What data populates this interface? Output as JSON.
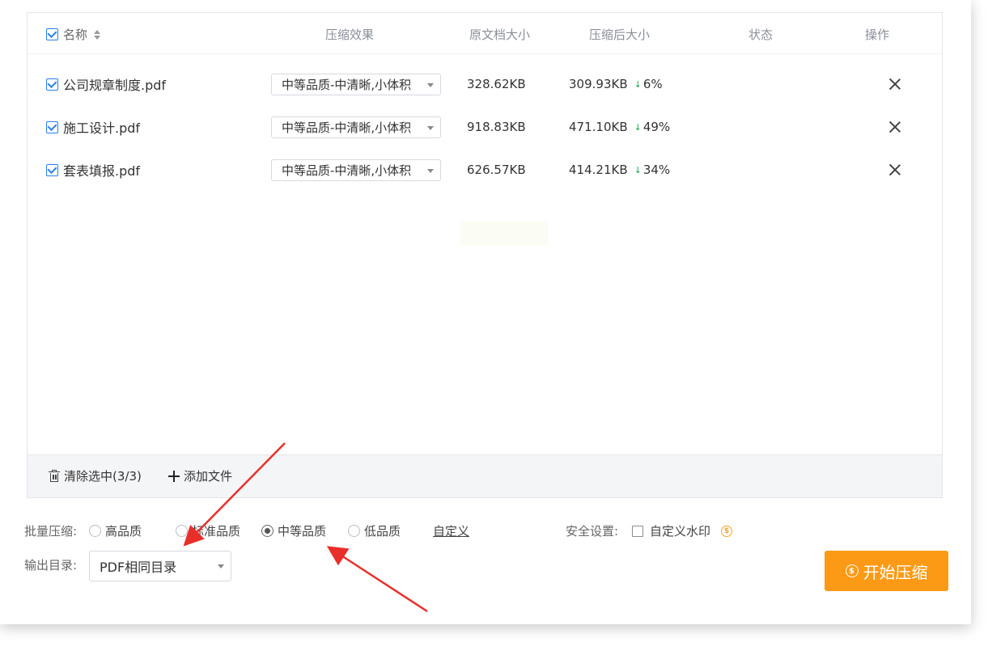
{
  "table": {
    "headers": {
      "name": "名称",
      "effect": "压缩效果",
      "original_size": "原文档大小",
      "compressed_size": "压缩后大小",
      "status": "状态",
      "operation": "操作"
    },
    "rows": [
      {
        "name": "公司规章制度.pdf",
        "effect": "中等品质-中清晰,小体积",
        "original": "328.62KB",
        "compressed": "309.93KB",
        "reduction": "6%"
      },
      {
        "name": "施工设计.pdf",
        "effect": "中等品质-中清晰,小体积",
        "original": "918.83KB",
        "compressed": "471.10KB",
        "reduction": "49%"
      },
      {
        "name": "套表填报.pdf",
        "effect": "中等品质-中清晰,小体积",
        "original": "626.57KB",
        "compressed": "414.21KB",
        "reduction": "34%"
      }
    ],
    "footer": {
      "clear_label": "清除选中(3/3)",
      "add_label": "添加文件"
    }
  },
  "batch": {
    "label": "批量压缩:",
    "options": [
      "高品质",
      "标准品质",
      "中等品质",
      "低品质"
    ],
    "selected": "中等品质",
    "custom_label": "自定义"
  },
  "security": {
    "label": "安全设置:",
    "watermark_label": "自定义水印",
    "watermark_checked": false
  },
  "output": {
    "label": "输出目录:",
    "value": "PDF相同目录"
  },
  "start_button": "开始压缩",
  "colors": {
    "accent_blue": "#2a7ff0",
    "start_orange": "#fd9a15",
    "down_green": "#1aa551",
    "annotation_red": "#e8302a"
  }
}
